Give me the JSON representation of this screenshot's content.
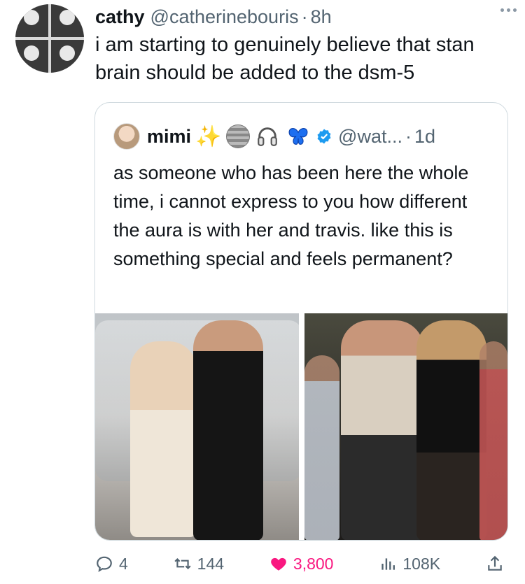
{
  "tweet": {
    "author_name": "cathy",
    "author_handle": "@catherinebouris",
    "separator": "·",
    "time": "8h",
    "text": "i am starting to genuinely believe that stan brain should be added to the dsm-5"
  },
  "quote": {
    "author_name": "mimi",
    "author_emojis": [
      "dizzy-star",
      "mirror-ball",
      "headphones",
      "blue-butterfly"
    ],
    "verified": true,
    "handle": "@wat...",
    "separator": "·",
    "time": "1d",
    "text": "as someone who has been here the whole time, i cannot express to you how different the aura is with her and travis. like this is something special and feels permanent?",
    "photos": [
      "photo-1",
      "photo-2"
    ]
  },
  "actions": {
    "replies": "4",
    "retweets": "144",
    "likes": "3,800",
    "views": "108K"
  },
  "colors": {
    "text_primary": "#0f1419",
    "text_secondary": "#536471",
    "border": "#cfd9de",
    "like": "#f91880",
    "verified": "#1d9bf0"
  }
}
